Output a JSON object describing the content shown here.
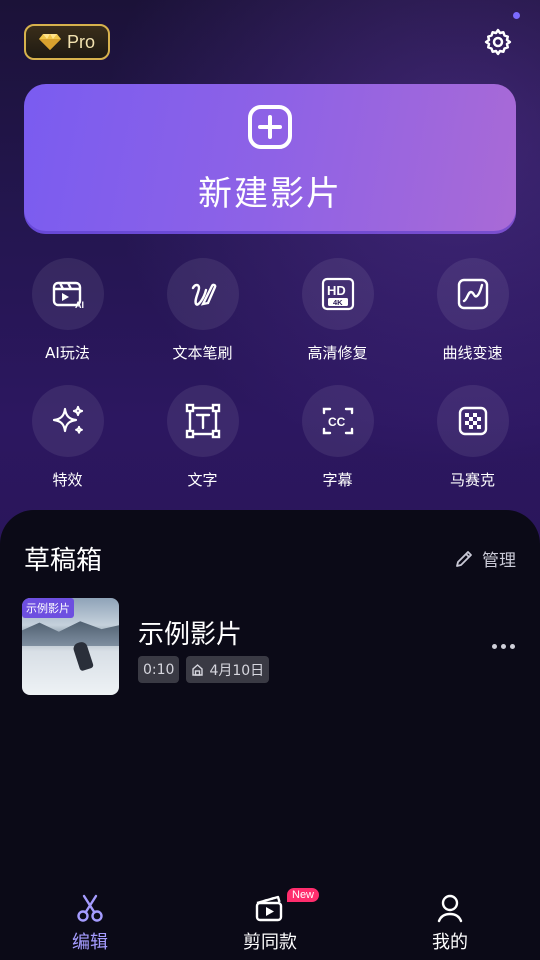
{
  "header": {
    "pro_label": "Pro",
    "icons": {
      "pro": "gem-icon",
      "settings": "gear-icon"
    }
  },
  "new_project": {
    "label": "新建影片",
    "icon": "plus-square-icon"
  },
  "tools": [
    {
      "label": "AI玩法",
      "icon": "ai-film-icon"
    },
    {
      "label": "文本笔刷",
      "icon": "brush-icon"
    },
    {
      "label": "高清修复",
      "icon": "hd-4k-icon"
    },
    {
      "label": "曲线变速",
      "icon": "curve-icon"
    },
    {
      "label": "特效",
      "icon": "sparkle-icon"
    },
    {
      "label": "文字",
      "icon": "text-frame-icon"
    },
    {
      "label": "字幕",
      "icon": "cc-icon"
    },
    {
      "label": "马赛克",
      "icon": "mosaic-icon"
    }
  ],
  "drafts": {
    "title": "草稿箱",
    "manage_label": "管理",
    "items": [
      {
        "thumb_tag": "示例影片",
        "name": "示例影片",
        "duration": "0:10",
        "date": "4月10日"
      }
    ]
  },
  "tabbar": {
    "tabs": [
      {
        "label": "编辑",
        "icon": "scissors-icon",
        "active": true
      },
      {
        "label": "剪同款",
        "icon": "clapper-icon",
        "badge": "New"
      },
      {
        "label": "我的",
        "icon": "user-icon"
      }
    ]
  },
  "colors": {
    "accent": "#a59cff",
    "pro_gold": "#d7b24d",
    "badge_red": "#ff2d6d"
  }
}
